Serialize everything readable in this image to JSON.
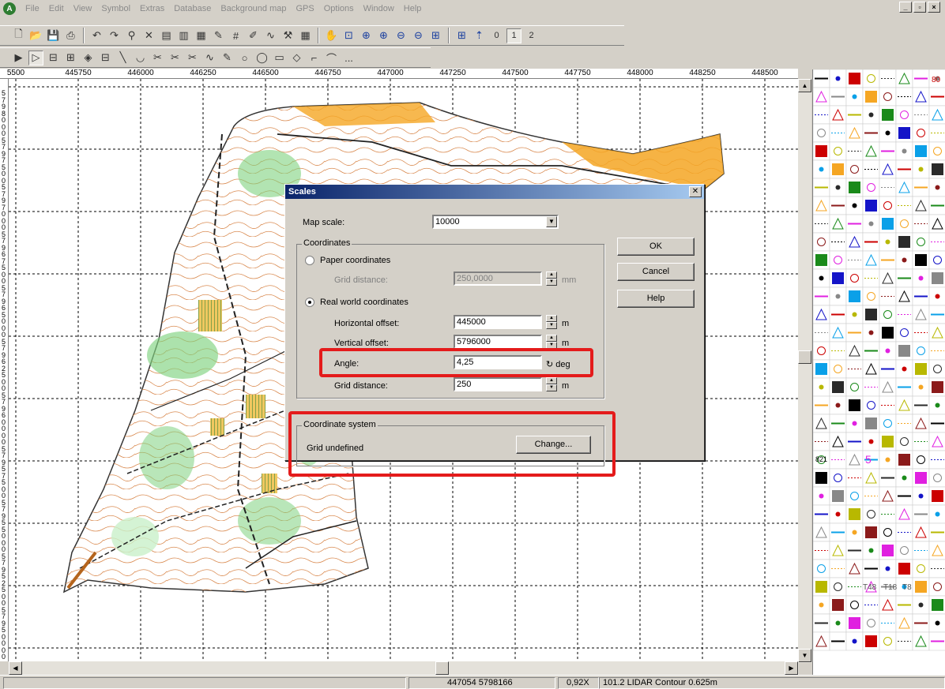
{
  "app": {
    "logo": "A",
    "menu": [
      "File",
      "Edit",
      "View",
      "Symbol",
      "Extras",
      "Database",
      "Background map",
      "GPS",
      "Options",
      "Window",
      "Help"
    ],
    "window_controls": [
      "_",
      "▫",
      "×"
    ]
  },
  "toolbar1": [
    "new",
    "open",
    "save",
    "print",
    "undo",
    "redo",
    "find",
    "delete",
    "symbols",
    "symbols2",
    "symbols3",
    "pen",
    "hash",
    "edit",
    "bezier",
    "tool",
    "grid",
    "hand",
    "zoom-window",
    "zoom-in",
    "zoom-in2",
    "zoom-out",
    "zoom-out2",
    "zoom-all",
    "grid-toggle",
    "north"
  ],
  "toolbar1_layers": [
    "0",
    "1",
    "2"
  ],
  "toolbar2": [
    "pointer",
    "select",
    "tool-a",
    "tool-b",
    "tool-c",
    "tool-d",
    "line",
    "curve",
    "scissors1",
    "scissors2",
    "scissors3",
    "bezier",
    "pen",
    "circle",
    "ellipse",
    "rectangle",
    "polygon",
    "measure",
    "line-tool"
  ],
  "toolbar2_more": "...",
  "ruler": {
    "x_labels": [
      "5500",
      "445750",
      "446000",
      "446250",
      "446500",
      "446750",
      "447000",
      "447250",
      "447500",
      "447750",
      "448000",
      "448250",
      "448500"
    ],
    "y_labels": [
      "5",
      "7",
      "9",
      "8",
      "0",
      "0",
      "0",
      "5",
      "7",
      "9",
      "7",
      "5",
      "0",
      "0",
      "5",
      "7",
      "9",
      "7",
      "0",
      "0",
      "0",
      "5",
      "7",
      "9",
      "6",
      "7",
      "5",
      "0",
      "0",
      "5",
      "7",
      "9",
      "6",
      "5",
      "0",
      "0",
      "0",
      "5",
      "7",
      "9",
      "6",
      "2",
      "5",
      "0",
      "0",
      "5",
      "7",
      "9",
      "6",
      "0",
      "0",
      "0",
      "0",
      "5",
      "7",
      "9",
      "5",
      "7",
      "5",
      "0",
      "0",
      "5",
      "7",
      "9",
      "5",
      "5",
      "0",
      "0",
      "0",
      "5",
      "7",
      "9",
      "5",
      "2",
      "5",
      "0",
      "0",
      "5",
      "7",
      "9",
      "5",
      "0",
      "0",
      "0",
      "0"
    ]
  },
  "status": {
    "coords": "447054  5798166",
    "zoom": "0,92X",
    "symbol": "101.2 LIDAR Contour 0.625m"
  },
  "dialog": {
    "title": "Scales",
    "map_scale_label": "Map scale:",
    "map_scale_value": "10000",
    "coordinates_group": "Coordinates",
    "paper_label": "Paper coordinates",
    "grid_distance_paper_label": "Grid distance:",
    "grid_distance_paper_value": "250,0000",
    "grid_distance_paper_unit": "mm",
    "real_world_label": "Real world coordinates",
    "h_offset_label": "Horizontal offset:",
    "h_offset_value": "445000",
    "h_offset_unit": "m",
    "v_offset_label": "Vertical offset:",
    "v_offset_value": "5796000",
    "v_offset_unit": "m",
    "angle_label": "Angle:",
    "angle_value": "4,25",
    "angle_unit": "deg",
    "grid_distance_label": "Grid distance:",
    "grid_distance_value": "250",
    "grid_distance_unit": "m",
    "ok": "OK",
    "cancel": "Cancel",
    "help": "Help",
    "coord_system_group": "Coordinate system",
    "coord_system_value": "Grid undefined",
    "change": "Change..."
  },
  "symbol_panel": {
    "label_821": "821",
    "label_5": "5",
    "label_t48": "T48",
    "label_t18": "T18",
    "label_t8": "T8",
    "label_80": "80"
  },
  "colors": {
    "highlight": "#e41b1b",
    "title_bar": "#0a246a",
    "map_green": "#7fd27f",
    "map_orange": "#f5a623",
    "contour": "#d2691e"
  }
}
